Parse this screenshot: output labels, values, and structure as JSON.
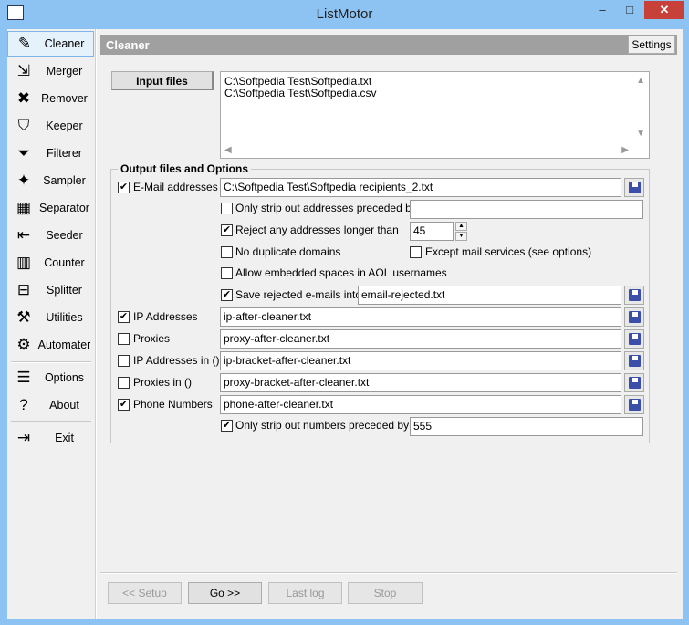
{
  "window": {
    "title": "ListMotor",
    "minimize": "–",
    "maximize": "□",
    "close": "✕"
  },
  "sidebar": {
    "items": [
      {
        "label": "Cleaner",
        "icon": "eraser-icon",
        "glyph": "✎"
      },
      {
        "label": "Merger",
        "icon": "merge-icon",
        "glyph": "⇲"
      },
      {
        "label": "Remover",
        "icon": "remove-icon",
        "glyph": "✖"
      },
      {
        "label": "Keeper",
        "icon": "keeper-icon",
        "glyph": "⛉"
      },
      {
        "label": "Filterer",
        "icon": "funnel-icon",
        "glyph": "⏷"
      },
      {
        "label": "Sampler",
        "icon": "sampler-icon",
        "glyph": "✦"
      },
      {
        "label": "Separator",
        "icon": "grid-icon",
        "glyph": "▦"
      },
      {
        "label": "Seeder",
        "icon": "seeder-icon",
        "glyph": "⇤"
      },
      {
        "label": "Counter",
        "icon": "counter-icon",
        "glyph": "▥"
      },
      {
        "label": "Splitter",
        "icon": "splitter-icon",
        "glyph": "⊟"
      },
      {
        "label": "Utilities",
        "icon": "hammer-icon",
        "glyph": "⚒"
      },
      {
        "label": "Automater",
        "icon": "gear-icon",
        "glyph": "⚙"
      },
      {
        "label": "Options",
        "icon": "options-icon",
        "glyph": "☰"
      },
      {
        "label": "About",
        "icon": "help-icon",
        "glyph": "?"
      },
      {
        "label": "Exit",
        "icon": "exit-door-icon",
        "glyph": "⇥"
      }
    ]
  },
  "header": {
    "title": "Cleaner",
    "settings": "Settings"
  },
  "input": {
    "button": "Input files",
    "files": [
      "C:\\Softpedia Test\\Softpedia.txt",
      "C:\\Softpedia Test\\Softpedia.csv"
    ]
  },
  "group": {
    "title": "Output files and Options"
  },
  "email": {
    "label": "E-Mail addresses",
    "checked": true,
    "path": "C:\\Softpedia Test\\Softpedia recipients_2.txt",
    "strip_label": "Only strip out addresses preceded by",
    "strip_checked": false,
    "strip_value": "",
    "reject_label": "Reject any addresses longer than",
    "reject_checked": true,
    "reject_value": "45",
    "nodup_label": "No duplicate domains",
    "nodup_checked": false,
    "except_label": "Except mail services (see options)",
    "except_checked": false,
    "aol_label": "Allow embedded spaces in AOL usernames",
    "aol_checked": false,
    "saverej_label": "Save rejected e-mails into",
    "saverej_checked": true,
    "saverej_value": "email-rejected.txt"
  },
  "outputs": [
    {
      "label": "IP Addresses",
      "checked": true,
      "value": "ip-after-cleaner.txt"
    },
    {
      "label": "Proxies",
      "checked": false,
      "value": "proxy-after-cleaner.txt"
    },
    {
      "label": "IP Addresses in ()",
      "checked": false,
      "value": "ip-bracket-after-cleaner.txt"
    },
    {
      "label": "Proxies in ()",
      "checked": false,
      "value": "proxy-bracket-after-cleaner.txt"
    },
    {
      "label": "Phone Numbers",
      "checked": true,
      "value": "phone-after-cleaner.txt"
    }
  ],
  "phone": {
    "strip_label": "Only strip out numbers preceded by",
    "strip_checked": true,
    "strip_value": "555"
  },
  "footer": {
    "setup": "<< Setup",
    "go": "Go >>",
    "lastlog": "Last log",
    "stop": "Stop"
  },
  "checkmark": "✔"
}
